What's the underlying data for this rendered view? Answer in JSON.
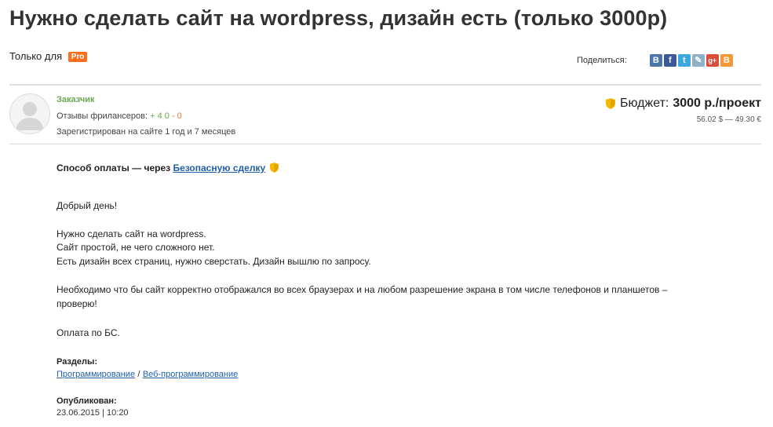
{
  "title": "Нужно сделать сайт на wordpress, дизайн есть (только 3000р)",
  "access": {
    "label": "Только для",
    "badge": "Pro"
  },
  "share": {
    "label": "Поделиться:",
    "buttons": [
      {
        "name": "vkontakte",
        "glyph": "В",
        "color": "#4a76a8"
      },
      {
        "name": "facebook",
        "glyph": "f",
        "color": "#3b5998"
      },
      {
        "name": "twitter",
        "glyph": "t",
        "color": "#3aa7e1"
      },
      {
        "name": "livejournal",
        "glyph": "✎",
        "color": "#8fb0c9"
      },
      {
        "name": "google-plus",
        "glyph": "g+",
        "color": "#dd4b39"
      },
      {
        "name": "blogger",
        "glyph": "B",
        "color": "#f49734"
      }
    ]
  },
  "customer": {
    "role": "Заказчик",
    "reviews_label": "Отзывы фрилансеров:",
    "reviews_positive": "+ 4",
    "reviews_neutral": "0",
    "reviews_negative": "- 0",
    "registered": "Зарегистрирован на сайте 1 год и 7 месяцев"
  },
  "budget": {
    "label": "Бюджет:",
    "value": "3000 р./проект",
    "rates": "56.02 $ — 49.30 €",
    "shield_color": "#f5b800"
  },
  "payment": {
    "prefix": "Способ оплаты — через",
    "link": "Безопасную сделку"
  },
  "description": {
    "greeting": "Добрый день!",
    "line1": "Нужно сделать сайт на wordpress.",
    "line2": "Сайт простой, не чего сложного нет.",
    "line3": "Есть дизайн всех страниц, нужно сверстать. Дизайн вышлю по запросу.",
    "line4a": "Необходимо что бы сайт корректно отображался во всех браузерах и на любом разрешение экрана в том числе телефонов и планшетов –",
    "line4b": "проверю!",
    "line5": "Оплата по БС."
  },
  "sections": {
    "label": "Разделы:",
    "link1": "Программирование",
    "separator": "/",
    "link2": "Веб-программирование"
  },
  "published": {
    "label": "Опубликован:",
    "date": "23.06.2015 | 10:20"
  },
  "colors": {
    "accent_link": "#1f5fa8",
    "pro_badge": "#ff6d1b",
    "positive": "#6aa84f",
    "negative": "#e07b39"
  }
}
